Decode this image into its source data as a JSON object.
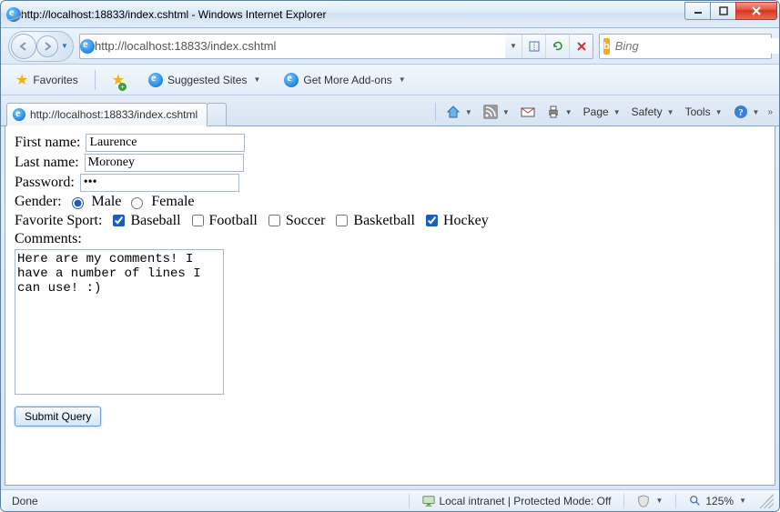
{
  "window": {
    "title": "http://localhost:18833/index.cshtml - Windows Internet Explorer"
  },
  "nav": {
    "url": "http://localhost:18833/index.cshtml",
    "search_placeholder": "Bing"
  },
  "favbar": {
    "favorites_label": "Favorites",
    "suggested_label": "Suggested Sites",
    "addons_label": "Get More Add-ons"
  },
  "tab": {
    "title": "http://localhost:18833/index.cshtml"
  },
  "cmdbar": {
    "page": "Page",
    "safety": "Safety",
    "tools": "Tools"
  },
  "form": {
    "first_name_label": "First name:",
    "first_name_value": "Laurence",
    "last_name_label": "Last name:",
    "last_name_value": "Moroney",
    "password_label": "Password:",
    "password_value": "•••",
    "gender_label": "Gender:",
    "gender_male": "Male",
    "gender_female": "Female",
    "gender_selected": "male",
    "fav_sport_label": "Favorite Sport:",
    "sports": {
      "baseball": "Baseball",
      "football": "Football",
      "soccer": "Soccer",
      "basketball": "Basketball",
      "hockey": "Hockey"
    },
    "sports_checked": [
      "baseball",
      "hockey"
    ],
    "comments_label": "Comments:",
    "comments_value": "Here are my comments! I have a number of lines I can use! :)",
    "submit_label": "Submit Query"
  },
  "status": {
    "done": "Done",
    "zone": "Local intranet | Protected Mode: Off",
    "zoom": "125%"
  }
}
